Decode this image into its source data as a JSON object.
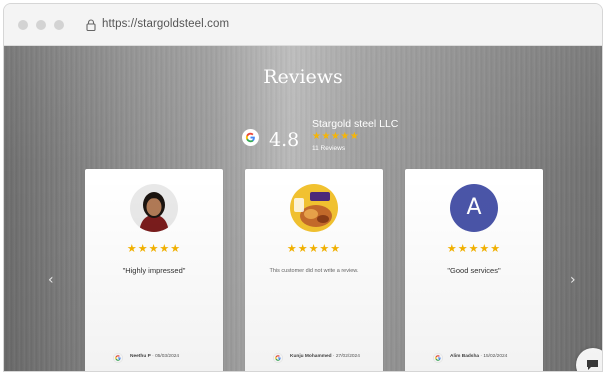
{
  "browser": {
    "url": "https://stargoldsteel.com"
  },
  "header": {
    "title": "Reviews"
  },
  "summary": {
    "rating": "4.8",
    "business_name": "Stargold steel LLC",
    "stars": "★★★★★",
    "review_count": "11 Reviews",
    "icon": "google-icon"
  },
  "reviews": [
    {
      "stars": "★★★★★",
      "text": "\"Highly impressed\"",
      "reviewer": "Neethu P",
      "date": "· 05/03/2024",
      "avatar": "photo"
    },
    {
      "stars": "★★★★★",
      "text": "This customer did not write a review.",
      "reviewer": "Kunju Mohammed",
      "date": "· 27/02/2024",
      "avatar": "photo"
    },
    {
      "stars": "★★★★★",
      "text": "\"Good services\"",
      "reviewer": "Alim Badsha",
      "date": "· 15/02/2024",
      "avatar_letter": "A",
      "avatar_color": "#4a55a8"
    }
  ],
  "carousel": {
    "prev": "‹",
    "next": "›"
  },
  "colors": {
    "star": "#f5b301",
    "google_blue": "#4285f4",
    "google_red": "#ea4335",
    "google_yellow": "#fbbc05",
    "google_green": "#34a853"
  }
}
